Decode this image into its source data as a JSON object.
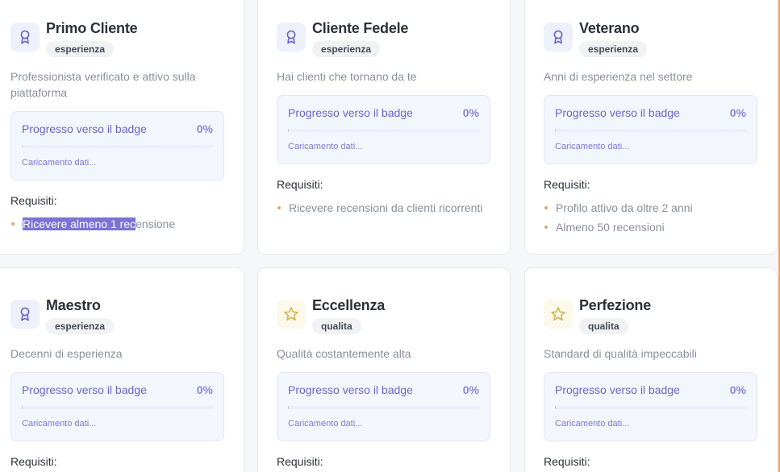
{
  "progress_label": "Progresso verso il badge",
  "progress_value": "0%",
  "progress_fraction": 0,
  "loading_text": "Caricamento dati...",
  "requirements_title": "Requisiti:",
  "colors": {
    "accent": "#6b65c9",
    "bullet": "#e6a56a",
    "highlight": "#7b73d6"
  },
  "badges": [
    {
      "title": "Primo Cliente",
      "tag": "esperienza",
      "icon": "award-ribbon-icon",
      "description": "Professionista verificato e attivo sulla piattaforma",
      "requirements": [
        "Ricevere almeno 1 recensione"
      ],
      "selected_text": "Ricevere almeno 1 rec",
      "unselected_text": "ensione"
    },
    {
      "title": "Cliente Fedele",
      "tag": "esperienza",
      "icon": "award-ribbon-icon",
      "description": "Hai clienti che tornano da te",
      "requirements": [
        "Ricevere recensioni da clienti ricorrenti"
      ]
    },
    {
      "title": "Veterano",
      "tag": "esperienza",
      "icon": "award-ribbon-icon",
      "description": "Anni di esperienza nel settore",
      "requirements": [
        "Profilo attivo da oltre 2 anni",
        "Almeno 50 recensioni"
      ]
    },
    {
      "title": "Maestro",
      "tag": "esperienza",
      "icon": "award-ribbon-icon",
      "description": "Decenni di esperienza",
      "requirements": []
    },
    {
      "title": "Eccellenza",
      "tag": "qualita",
      "icon": "star-icon",
      "description": "Qualità costantemente alta",
      "requirements": []
    },
    {
      "title": "Perfezione",
      "tag": "qualita",
      "icon": "star-icon",
      "description": "Standard di qualità impeccabili",
      "requirements": []
    }
  ]
}
